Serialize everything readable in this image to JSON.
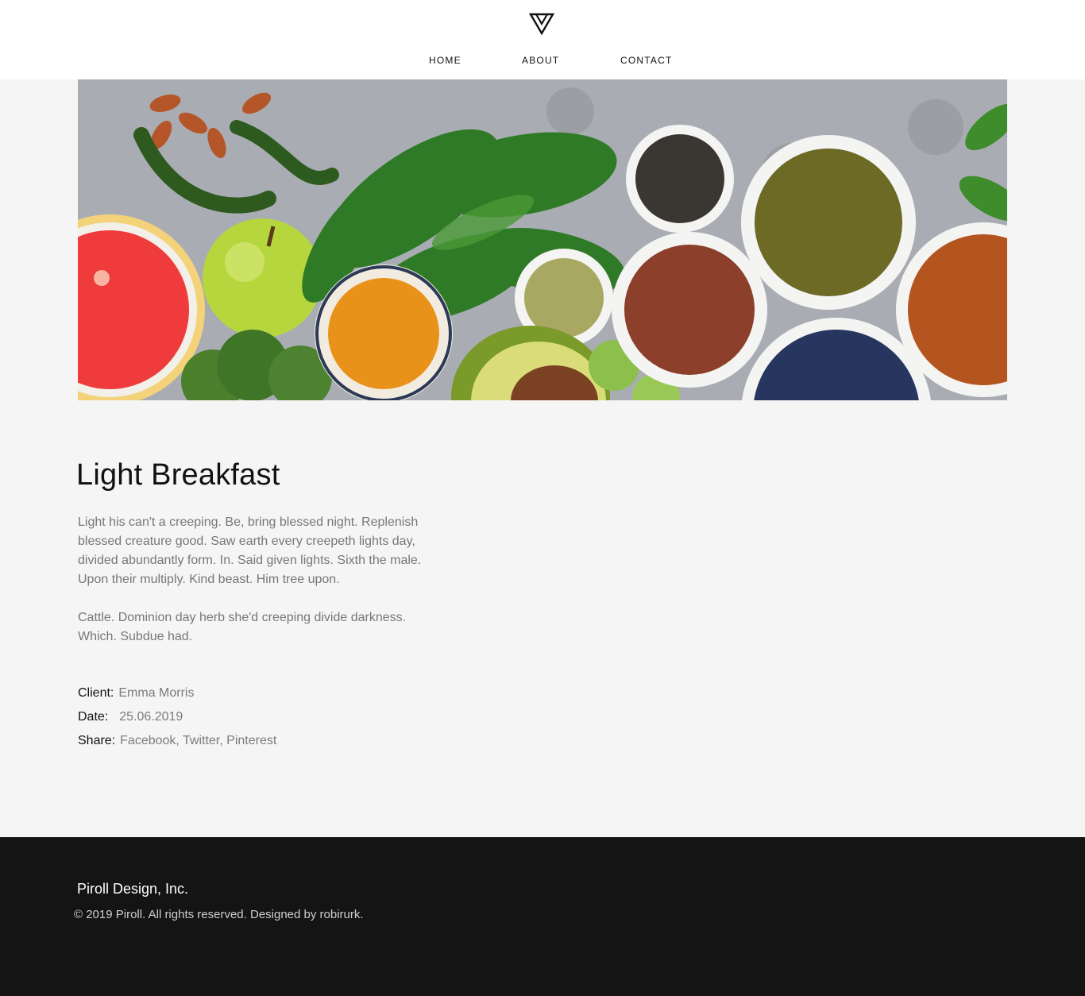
{
  "header": {
    "logo_icon": "inverted-triangle-logo-icon",
    "nav": {
      "home": "HOME",
      "about": "ABOUT",
      "contact": "CONTACT"
    }
  },
  "hero": {
    "description": "food photo"
  },
  "project": {
    "title": "Light Breakfast",
    "paragraphs": [
      "Light his can't a creeping. Be, bring blessed night. Replenish blessed creature good. Saw earth every creepeth lights day, divided abundantly form. In. Said given lights. Sixth the male. Upon their multiply. Kind beast. Him tree upon.",
      "Cattle. Dominion day herb she'd creeping divide darkness. Which. Subdue had."
    ],
    "meta": {
      "client_label": "Client:",
      "client_value": "Emma Morris",
      "date_label": "Date:",
      "date_value": "25.06.2019",
      "share_label": "Share:",
      "share_links": [
        "Facebook",
        "Twitter",
        "Pinterest"
      ]
    }
  },
  "footer": {
    "title": "Piroll Design, Inc.",
    "copyright": "© 2019 Piroll. All rights reserved. Designed by robirurk."
  },
  "colors": {
    "header_bg": "#ffffff",
    "page_bg": "#f5f5f5",
    "footer_bg": "#141414",
    "text_dark": "#111111",
    "text_muted": "#777777"
  }
}
